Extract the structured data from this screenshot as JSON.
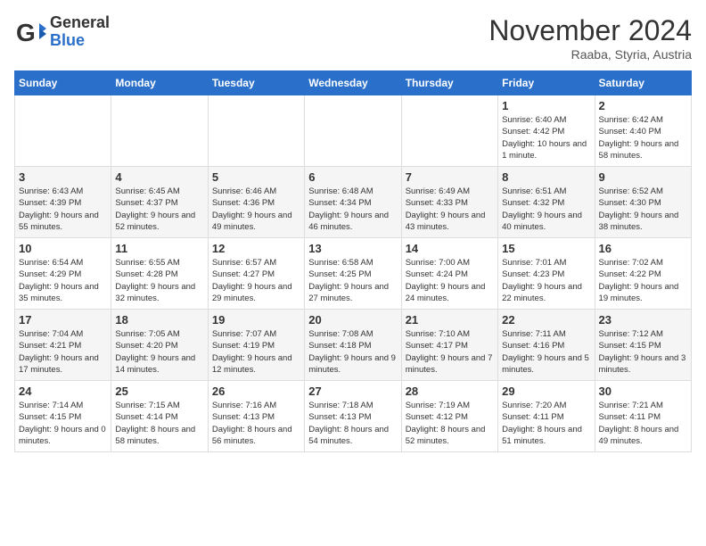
{
  "header": {
    "logo_general": "General",
    "logo_blue": "Blue",
    "month_title": "November 2024",
    "location": "Raaba, Styria, Austria"
  },
  "days_of_week": [
    "Sunday",
    "Monday",
    "Tuesday",
    "Wednesday",
    "Thursday",
    "Friday",
    "Saturday"
  ],
  "weeks": [
    [
      {
        "day": "",
        "info": ""
      },
      {
        "day": "",
        "info": ""
      },
      {
        "day": "",
        "info": ""
      },
      {
        "day": "",
        "info": ""
      },
      {
        "day": "",
        "info": ""
      },
      {
        "day": "1",
        "info": "Sunrise: 6:40 AM\nSunset: 4:42 PM\nDaylight: 10 hours and 1 minute."
      },
      {
        "day": "2",
        "info": "Sunrise: 6:42 AM\nSunset: 4:40 PM\nDaylight: 9 hours and 58 minutes."
      }
    ],
    [
      {
        "day": "3",
        "info": "Sunrise: 6:43 AM\nSunset: 4:39 PM\nDaylight: 9 hours and 55 minutes."
      },
      {
        "day": "4",
        "info": "Sunrise: 6:45 AM\nSunset: 4:37 PM\nDaylight: 9 hours and 52 minutes."
      },
      {
        "day": "5",
        "info": "Sunrise: 6:46 AM\nSunset: 4:36 PM\nDaylight: 9 hours and 49 minutes."
      },
      {
        "day": "6",
        "info": "Sunrise: 6:48 AM\nSunset: 4:34 PM\nDaylight: 9 hours and 46 minutes."
      },
      {
        "day": "7",
        "info": "Sunrise: 6:49 AM\nSunset: 4:33 PM\nDaylight: 9 hours and 43 minutes."
      },
      {
        "day": "8",
        "info": "Sunrise: 6:51 AM\nSunset: 4:32 PM\nDaylight: 9 hours and 40 minutes."
      },
      {
        "day": "9",
        "info": "Sunrise: 6:52 AM\nSunset: 4:30 PM\nDaylight: 9 hours and 38 minutes."
      }
    ],
    [
      {
        "day": "10",
        "info": "Sunrise: 6:54 AM\nSunset: 4:29 PM\nDaylight: 9 hours and 35 minutes."
      },
      {
        "day": "11",
        "info": "Sunrise: 6:55 AM\nSunset: 4:28 PM\nDaylight: 9 hours and 32 minutes."
      },
      {
        "day": "12",
        "info": "Sunrise: 6:57 AM\nSunset: 4:27 PM\nDaylight: 9 hours and 29 minutes."
      },
      {
        "day": "13",
        "info": "Sunrise: 6:58 AM\nSunset: 4:25 PM\nDaylight: 9 hours and 27 minutes."
      },
      {
        "day": "14",
        "info": "Sunrise: 7:00 AM\nSunset: 4:24 PM\nDaylight: 9 hours and 24 minutes."
      },
      {
        "day": "15",
        "info": "Sunrise: 7:01 AM\nSunset: 4:23 PM\nDaylight: 9 hours and 22 minutes."
      },
      {
        "day": "16",
        "info": "Sunrise: 7:02 AM\nSunset: 4:22 PM\nDaylight: 9 hours and 19 minutes."
      }
    ],
    [
      {
        "day": "17",
        "info": "Sunrise: 7:04 AM\nSunset: 4:21 PM\nDaylight: 9 hours and 17 minutes."
      },
      {
        "day": "18",
        "info": "Sunrise: 7:05 AM\nSunset: 4:20 PM\nDaylight: 9 hours and 14 minutes."
      },
      {
        "day": "19",
        "info": "Sunrise: 7:07 AM\nSunset: 4:19 PM\nDaylight: 9 hours and 12 minutes."
      },
      {
        "day": "20",
        "info": "Sunrise: 7:08 AM\nSunset: 4:18 PM\nDaylight: 9 hours and 9 minutes."
      },
      {
        "day": "21",
        "info": "Sunrise: 7:10 AM\nSunset: 4:17 PM\nDaylight: 9 hours and 7 minutes."
      },
      {
        "day": "22",
        "info": "Sunrise: 7:11 AM\nSunset: 4:16 PM\nDaylight: 9 hours and 5 minutes."
      },
      {
        "day": "23",
        "info": "Sunrise: 7:12 AM\nSunset: 4:15 PM\nDaylight: 9 hours and 3 minutes."
      }
    ],
    [
      {
        "day": "24",
        "info": "Sunrise: 7:14 AM\nSunset: 4:15 PM\nDaylight: 9 hours and 0 minutes."
      },
      {
        "day": "25",
        "info": "Sunrise: 7:15 AM\nSunset: 4:14 PM\nDaylight: 8 hours and 58 minutes."
      },
      {
        "day": "26",
        "info": "Sunrise: 7:16 AM\nSunset: 4:13 PM\nDaylight: 8 hours and 56 minutes."
      },
      {
        "day": "27",
        "info": "Sunrise: 7:18 AM\nSunset: 4:13 PM\nDaylight: 8 hours and 54 minutes."
      },
      {
        "day": "28",
        "info": "Sunrise: 7:19 AM\nSunset: 4:12 PM\nDaylight: 8 hours and 52 minutes."
      },
      {
        "day": "29",
        "info": "Sunrise: 7:20 AM\nSunset: 4:11 PM\nDaylight: 8 hours and 51 minutes."
      },
      {
        "day": "30",
        "info": "Sunrise: 7:21 AM\nSunset: 4:11 PM\nDaylight: 8 hours and 49 minutes."
      }
    ]
  ]
}
